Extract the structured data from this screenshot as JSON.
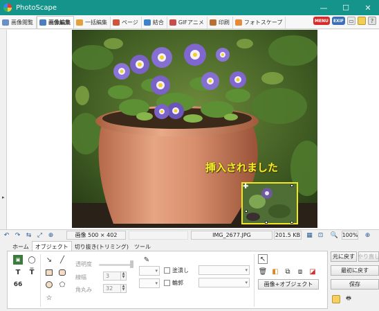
{
  "window": {
    "title": "PhotoScape",
    "minimize_glyph": "—",
    "maximize_glyph": "☐",
    "close_glyph": "✕"
  },
  "tabs": [
    {
      "label": "画像閲覧",
      "icon": "viewer-icon",
      "color": "#6a8fc7"
    },
    {
      "label": "画像編集",
      "icon": "editor-icon",
      "color": "#4b7ec1"
    },
    {
      "label": "一括編集",
      "icon": "batch-icon",
      "color": "#e2a13c"
    },
    {
      "label": "ページ",
      "icon": "page-icon",
      "color": "#d0533e"
    },
    {
      "label": "結合",
      "icon": "combine-icon",
      "color": "#3e82c9"
    },
    {
      "label": "GIFアニメ",
      "icon": "gif-icon",
      "color": "#c84a4a"
    },
    {
      "label": "印刷",
      "icon": "print-icon",
      "color": "#b86f35"
    },
    {
      "label": "フォトスケープ",
      "icon": "photoscape-icon",
      "color": "#e5893a"
    }
  ],
  "top_right": {
    "menu_badge": "MENU",
    "exif_badge": "EXIF",
    "menu_color": "#d62b2b",
    "exif_color": "#3a6fb5"
  },
  "canvas": {
    "inserted_text": "挿入されました",
    "move_glyph": "✚"
  },
  "statusbar": {
    "image_size": "画像 500 × 402",
    "filename": "IMG_2677.JPG",
    "filesize": "201.5 KB",
    "zoom": "100%"
  },
  "edit_tabs": [
    "ホーム",
    "オブジェクト",
    "切り抜き(トリミング)",
    "ツール"
  ],
  "object_panel": {
    "opacity_label": "透明度",
    "line_width_label": "線幅",
    "line_width_value": "3",
    "round_label": "角丸み",
    "round_value": "32",
    "fill_label": "塗潰し",
    "outline_label": "輪郭",
    "image_object_button": "画像+オブジェクト",
    "quote_glyph": "66"
  },
  "right_buttons": {
    "undo": "元に戻す",
    "redo": "やり直し",
    "undo_all": "最初に戻す",
    "save": "保存"
  }
}
